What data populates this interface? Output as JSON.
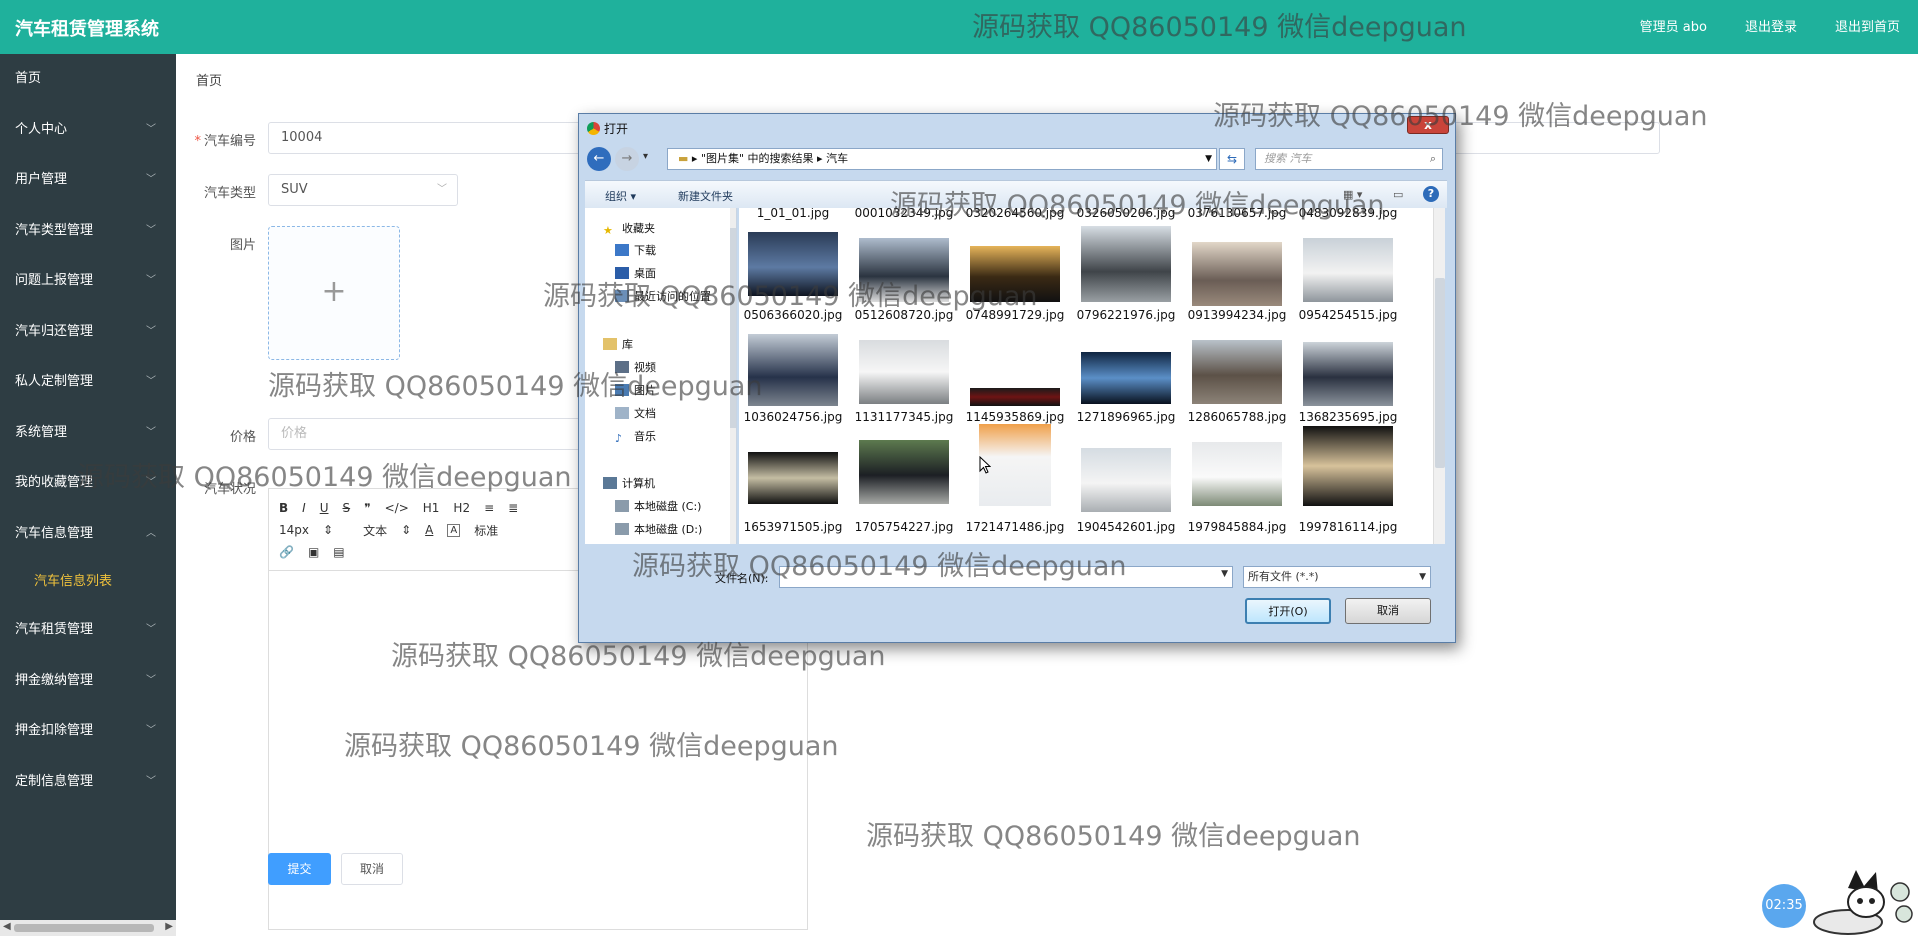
{
  "app": {
    "title": "汽车租赁管理系统",
    "admin_label": "管理员 abo",
    "logout": "退出登录",
    "home_exit": "退出到首页"
  },
  "sidebar": {
    "items": [
      {
        "label": "首页",
        "chevron": false
      },
      {
        "label": "个人中心",
        "chevron": true
      },
      {
        "label": "用户管理",
        "chevron": true
      },
      {
        "label": "汽车类型管理",
        "chevron": true
      },
      {
        "label": "问题上报管理",
        "chevron": true
      },
      {
        "label": "汽车归还管理",
        "chevron": true
      },
      {
        "label": "私人定制管理",
        "chevron": true
      },
      {
        "label": "系统管理",
        "chevron": true
      },
      {
        "label": "我的收藏管理",
        "chevron": true
      },
      {
        "label": "汽车信息管理",
        "chevron": true,
        "expanded": true
      }
    ],
    "sub_item": "汽车信息列表",
    "items_after": [
      {
        "label": "汽车租赁管理"
      },
      {
        "label": "押金缴纳管理"
      },
      {
        "label": "押金扣除管理"
      },
      {
        "label": "定制信息管理"
      }
    ]
  },
  "main": {
    "breadcrumb": "首页",
    "form": {
      "car_no_label": "汽车编号",
      "car_no_value": "10004",
      "type_label": "汽车类型",
      "type_value": "SUV",
      "image_label": "图片",
      "upload_plus": "+",
      "price_label": "价格",
      "price_placeholder": "价格",
      "status_label": "汽车状况",
      "toolbar": {
        "row1": [
          "B",
          "I",
          "U",
          "S",
          "❞",
          "</>",
          "H1",
          "H2",
          "≡",
          "≣"
        ],
        "font_size": "14px",
        "text_style": "文本",
        "heading": "标准"
      },
      "submit": "提交",
      "cancel": "取消"
    }
  },
  "dialog": {
    "title": "打开",
    "close": "x",
    "address": "\"图片集\" 中的搜索结果 ▸ 汽车",
    "address_root": "▸",
    "search_placeholder": "搜索 汽车",
    "organize": "组织 ▾",
    "new_folder": "新建文件夹",
    "nav": {
      "favorites": "收藏夹",
      "downloads": "下载",
      "desktop": "桌面",
      "recent": "最近访问的位置",
      "libraries": "库",
      "videos": "视频",
      "pictures": "图片",
      "documents": "文档",
      "music": "音乐",
      "computer": "计算机",
      "disk_c": "本地磁盘 (C:)",
      "disk_d": "本地磁盘 (D:)"
    },
    "top_row": [
      "1_01_01.jpg",
      "0001032349.jpg",
      "0320264560.jpg",
      "0326050206.jpg",
      "0376130657.jpg",
      "0483092839.jpg"
    ],
    "files": [
      "0506366020.jpg",
      "0512608720.jpg",
      "0748991729.jpg",
      "0796221976.jpg",
      "0913994234.jpg",
      "0954254515.jpg",
      "1036024756.jpg",
      "1131177345.jpg",
      "1145935869.jpg",
      "1271896965.jpg",
      "1286065788.jpg",
      "1368235695.jpg",
      "1653971505.jpg",
      "1705754227.jpg",
      "1721471486.jpg",
      "1904542601.jpg",
      "1979845884.jpg",
      "1997816114.jpg"
    ],
    "filename_label": "文件名(N):",
    "filetype": "所有文件 (*.*)",
    "open": "打开(O)",
    "cancel": "取消"
  },
  "watermark": "源码获取 QQ86050149 微信deepguan",
  "clock": "02:35",
  "colors": {
    "topbar": "#1fb19c",
    "sidebar": "#2e3d43",
    "submenu_active": "#f0c23c",
    "primary": "#409eff"
  }
}
